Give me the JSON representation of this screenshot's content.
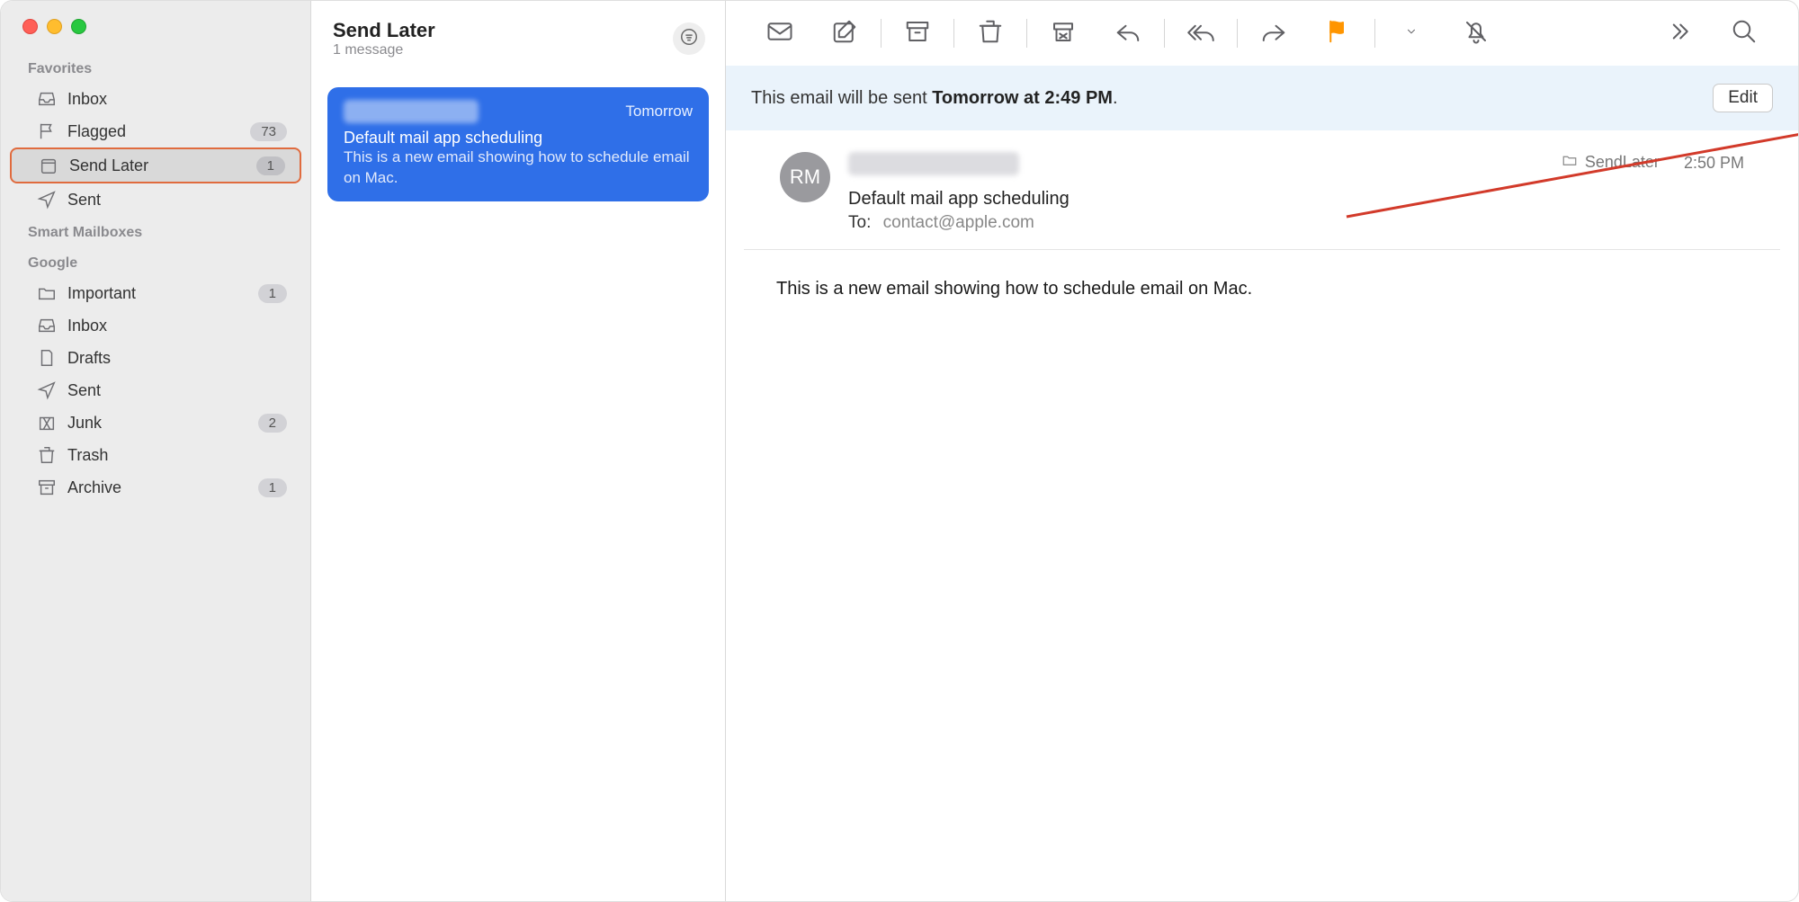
{
  "sidebar": {
    "sections": {
      "favorites": "Favorites",
      "smart": "Smart Mailboxes",
      "google": "Google"
    },
    "fav": [
      {
        "label": "Inbox"
      },
      {
        "label": "Flagged",
        "count": "73"
      },
      {
        "label": "Send Later",
        "count": "1"
      },
      {
        "label": "Sent"
      }
    ],
    "google_items": [
      {
        "label": "Important",
        "count": "1"
      },
      {
        "label": "Inbox"
      },
      {
        "label": "Drafts"
      },
      {
        "label": "Sent"
      },
      {
        "label": "Junk",
        "count": "2"
      },
      {
        "label": "Trash"
      },
      {
        "label": "Archive",
        "count": "1"
      }
    ]
  },
  "msglist": {
    "title": "Send Later",
    "subtitle": "1 message",
    "card": {
      "when": "Tomorrow",
      "subject": "Default mail app scheduling",
      "preview": "This is a new email showing how to schedule email on Mac."
    }
  },
  "banner": {
    "prefix": "This email will be sent ",
    "time": "Tomorrow at 2:49 PM",
    "suffix": ".",
    "edit": "Edit"
  },
  "mail": {
    "avatar_initials": "RM",
    "subject": "Default mail app scheduling",
    "to_label": "To:",
    "to_value": "contact@apple.com",
    "folder": "SendLater",
    "time": "2:50 PM",
    "body": "This is a new email showing how to schedule email on Mac."
  }
}
